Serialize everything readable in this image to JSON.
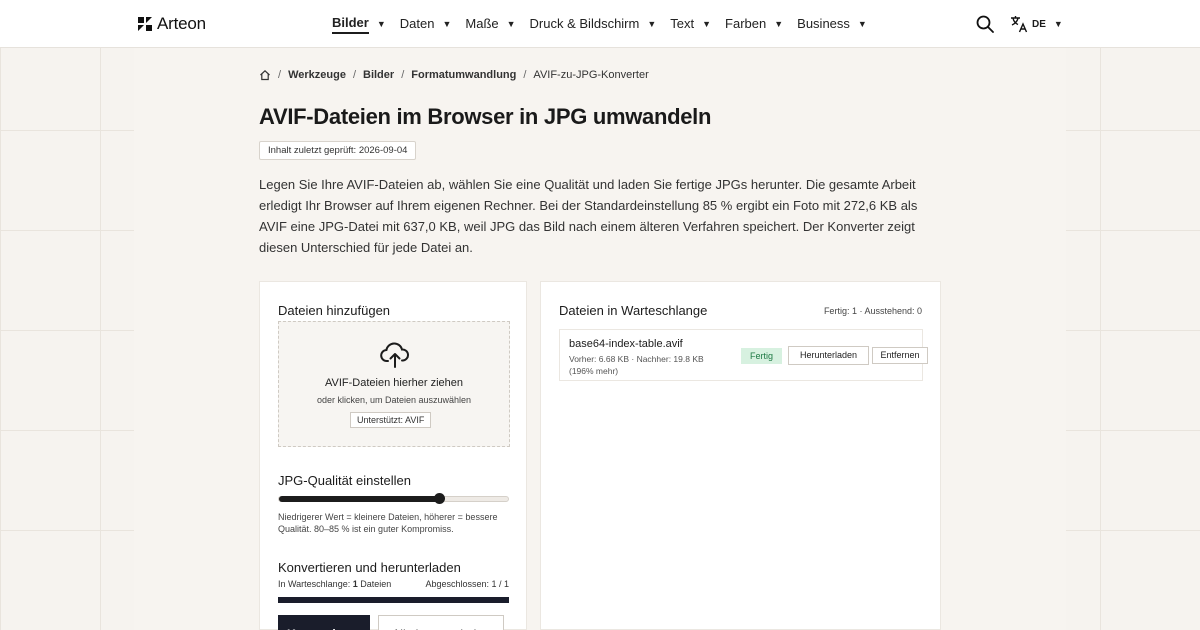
{
  "brand": {
    "name": "Arteon"
  },
  "nav": {
    "items": [
      {
        "label": "Bilder"
      },
      {
        "label": "Daten"
      },
      {
        "label": "Maße"
      },
      {
        "label": "Druck & Bildschirm"
      },
      {
        "label": "Text"
      },
      {
        "label": "Farben"
      },
      {
        "label": "Business"
      }
    ],
    "active_index": 0,
    "language": "DE"
  },
  "breadcrumb": [
    "Werkzeuge",
    "Bilder",
    "Formatumwandlung",
    "AVIF-zu-JPG-Konverter"
  ],
  "page": {
    "title": "AVIF-Dateien im Browser in JPG umwandeln",
    "checked": "Inhalt zuletzt geprüft: 2026-09-04",
    "intro": "Legen Sie Ihre AVIF-Dateien ab, wählen Sie eine Qualität und laden Sie fertige JPGs herunter. Die gesamte Arbeit erledigt Ihr Browser auf Ihrem eigenen Rechner. Bei der Standardeinstellung 85 % ergibt ein Foto mit 272,6 KB als AVIF eine JPG-Datei mit 637,0 KB, weil JPG das Bild nach einem älteren Verfahren speichert. Der Konverter zeigt diesen Unterschied für jede Datei an."
  },
  "add_files": {
    "heading": "Dateien hinzufügen",
    "drop_main": "AVIF-Dateien hierher ziehen",
    "drop_sub": "oder klicken, um Dateien auszuwählen",
    "supported": "Unterstützt: AVIF"
  },
  "quality": {
    "heading": "JPG-Qualität einstellen",
    "value_fraction": 0.7,
    "hint": "Niedrigerer Wert = kleinere Dateien, höherer = bessere Qualität. 80–85 % ist ein guter Kompromiss."
  },
  "convert": {
    "heading": "Konvertieren und herunterladen",
    "queue_label": "In Warteschlange:",
    "queue_count": "1",
    "queue_unit": "Dateien",
    "done_label": "Abgeschlossen: 1 / 1",
    "progress_fraction": 1.0,
    "convert_button": "Konvertieren",
    "download_all_button": "Alle herunterladen"
  },
  "queue": {
    "heading": "Dateien in Warteschlange",
    "status": "Fertig: 1 · Ausstehend: 0",
    "files": [
      {
        "name": "base64-index-table.avif",
        "meta": "Vorher: 6.68 KB · Nachher: 19.8 KB (196% mehr)",
        "status": "Fertig",
        "download": "Herunterladen",
        "remove": "Entfernen"
      }
    ]
  },
  "colors": {
    "accent_dark": "#1a1d2b",
    "success_bg": "#d7f1e0",
    "success_text": "#1f7a45"
  }
}
